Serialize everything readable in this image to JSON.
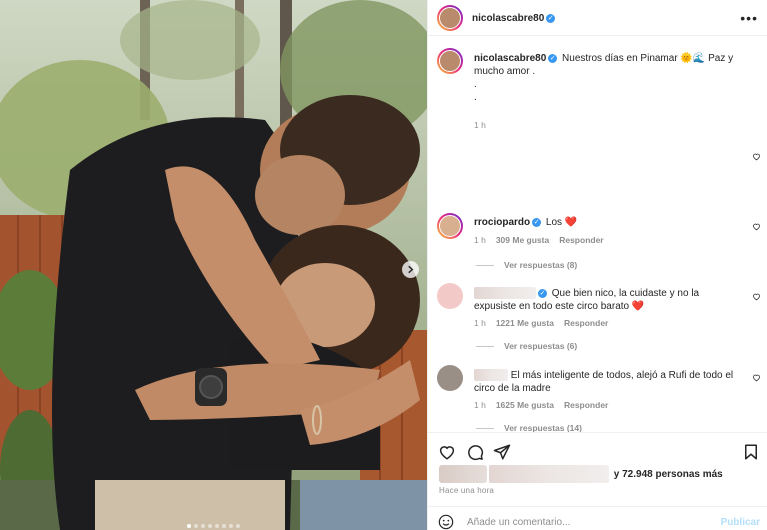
{
  "post": {
    "username": "nicolascabre80",
    "caption_text": "Nuestros días en Pinamar 🌞🌊 Paz y mucho amor .",
    "caption_line2": ".",
    "caption_line3": ".",
    "caption_time": "1 h",
    "more_icon": "more-icon",
    "photo_slides": 8,
    "active_slide": 1
  },
  "comments": [
    {
      "username": "rrociopardo",
      "verified": true,
      "text": "Los ❤️",
      "time": "1 h",
      "likes": "309 Me gusta",
      "reply_label": "Responder",
      "replies": "Ver respuestas (8)"
    },
    {
      "username": "",
      "verified": true,
      "text": "Que bien nico, la cuidaste y no la expusiste en todo este circo barato ❤️",
      "time": "1 h",
      "likes": "1221 Me gusta",
      "reply_label": "Responder",
      "replies": "Ver respuestas (6)"
    },
    {
      "username": "",
      "verified": false,
      "text": "El más inteligente de todos, alejó a Rufi de todo el circo de la madre",
      "time": "1 h",
      "likes": "1625 Me gusta",
      "reply_label": "Responder",
      "replies": "Ver respuestas (14)"
    }
  ],
  "footer": {
    "likes_text": "y 72.948 personas más",
    "time_ago": "Hace una hora",
    "comment_placeholder": "Añade un comentario...",
    "publish_label": "Publicar"
  },
  "colors": {
    "verified": "#3897f0",
    "heart_red": "#ed4956",
    "muted_text": "#8e8e8e",
    "publish_disabled": "#b2dffc"
  }
}
